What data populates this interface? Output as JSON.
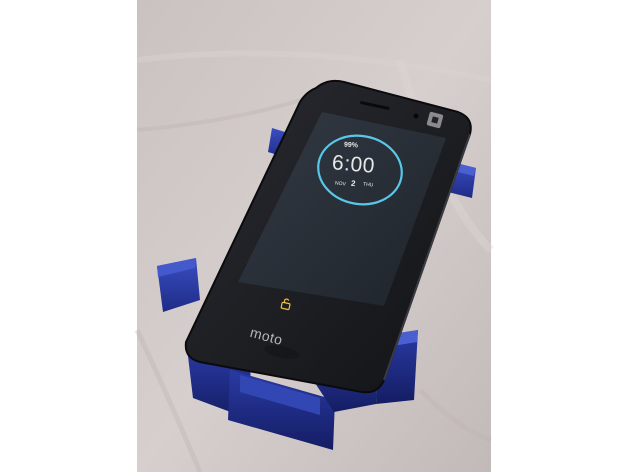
{
  "scene": {
    "background_color": "#ffffff",
    "surface_color": "#cfc8c6",
    "phone_body_color": "#1c1d22",
    "screen_color": "#2a3039",
    "stand_color": "#2a3aa4",
    "accent_ring_color": "#58c7e8"
  },
  "phone": {
    "lockscreen": {
      "battery": "99%",
      "time": "6:00",
      "month": "NOV",
      "day": "2",
      "weekday": "THU",
      "lock_icon": "unlock-icon"
    },
    "brand": "moto"
  }
}
